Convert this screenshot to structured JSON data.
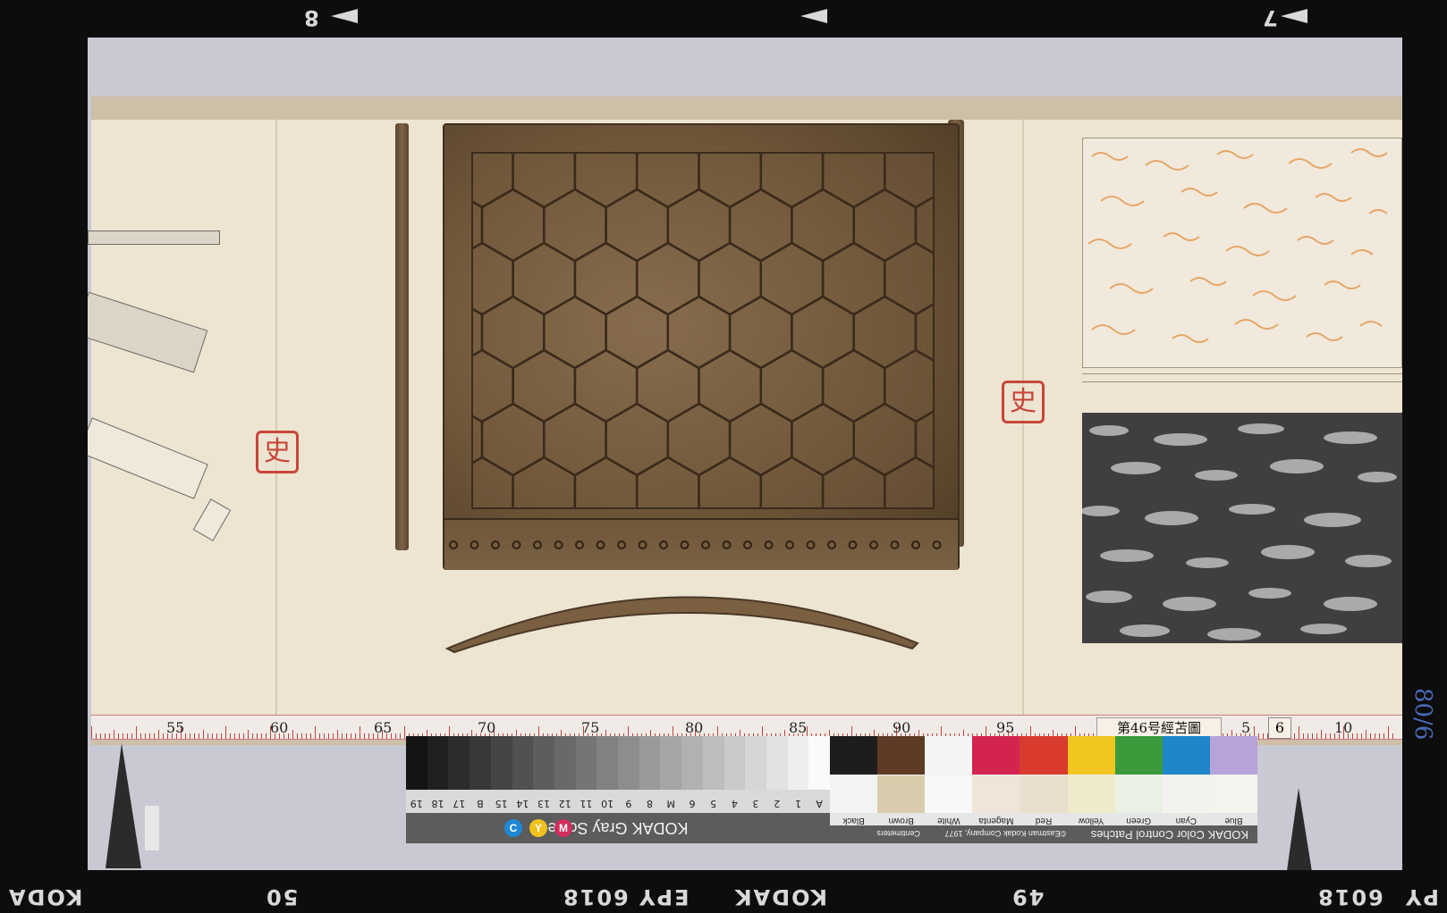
{
  "film": {
    "top_left_number": "8",
    "top_right_number": "7",
    "bottom_left_brand": "KODA",
    "bottom_frame_left": "50",
    "bottom_code_1": "6018",
    "bottom_code_2": "EPY 6018",
    "bottom_brand": "KODAK",
    "bottom_frame_right": "49",
    "bottom_code_3": "6018",
    "bottom_right_partial": "PY"
  },
  "seals": {
    "left": "史",
    "right": "史"
  },
  "ruler": {
    "numbers": [
      "55",
      "60",
      "65",
      "70",
      "75",
      "80",
      "85",
      "90",
      "95",
      "5",
      "10"
    ],
    "label": "第46号經苫圖",
    "box": "6"
  },
  "gray_scale": {
    "title": "KODAK Gray Scale",
    "steps": [
      "A",
      "1",
      "2",
      "3",
      "4",
      "5",
      "6",
      "M",
      "8",
      "9",
      "10",
      "11",
      "12",
      "13",
      "14",
      "15",
      "B",
      "17",
      "18",
      "19"
    ],
    "cmy": [
      "C",
      "Y",
      "M"
    ]
  },
  "color_card": {
    "title": "KODAK Color Control Patches",
    "subtitle": "©Eastman Kodak Company, 1977",
    "centimeters": "Centimeters",
    "names": [
      "Blue",
      "Cyan",
      "Green",
      "Yellow",
      "Red",
      "Magenta",
      "White",
      "Brown",
      "Black"
    ],
    "top_colors": [
      "#b7a3d9",
      "#1f86c9",
      "#3a9a3c",
      "#f0c61f",
      "#d83a2e",
      "#d32450",
      "#f4f4f4",
      "#5e3b26",
      "#1d1d1d"
    ],
    "bottom_colors": [
      "#f5f3ee",
      "#f4f2ee",
      "#eaf0e4",
      "#efeaca",
      "#eadfce",
      "#efe5d8",
      "#f8f8f8",
      "#d8ccac",
      "#f3f3f3"
    ]
  },
  "handwriting": "80/6"
}
